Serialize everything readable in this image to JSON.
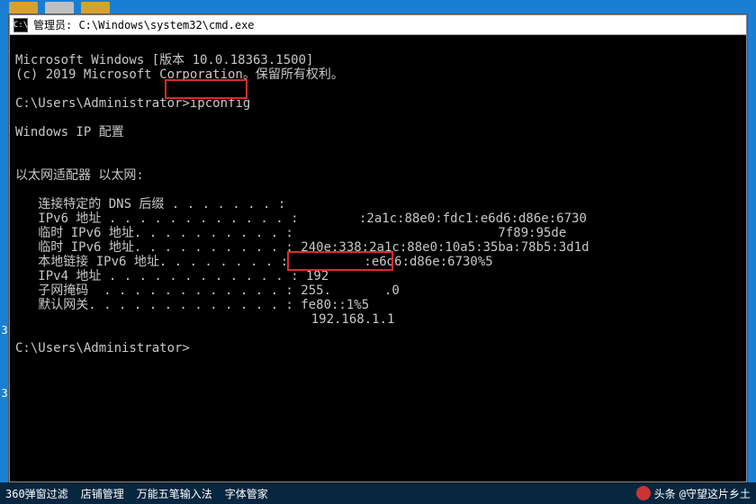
{
  "titlebar": {
    "icon_text": "C:\\",
    "text": "管理员: C:\\Windows\\system32\\cmd.exe"
  },
  "term": {
    "l1": "Microsoft Windows [版本 10.0.18363.1500]",
    "l2": "(c) 2019 Microsoft Corporation。保留所有权利。",
    "l3": "",
    "l4_prompt": "C:\\Users\\Administrator>",
    "l4_cmd": "ipconfig",
    "l5": "",
    "l6": "Windows IP 配置",
    "l7": "",
    "l8": "",
    "l9": "以太网适配器 以太网:",
    "l10": "",
    "l11": "   连接特定的 DNS 后缀 . . . . . . . :",
    "l12": "   IPv6 地址 . . . . . . . . . . . . :        :2a1c:88e0:fdc1:e6d6:d86e:6730",
    "l13": "   临时 IPv6 地址. . . . . . . . . . :                           7f89:95de",
    "l14": "   临时 IPv6 地址. . . . . . . . . . : 240e:338:2a1c:88e0:10a5:35ba:78b5:3d1d",
    "l15": "   本地链接 IPv6 地址. . . . . . . . :          :e6d6:d86e:6730%5",
    "l16": "   IPv4 地址 . . . . . . . . . . . . : 192",
    "l17": "   子网掩码  . . . . . . . . . . . . : 255.       .0",
    "l18": "   默认网关. . . . . . . . . . . . . : fe80::1%5",
    "l19": "                                       192.168.1.1",
    "l20": "",
    "l21": "C:\\Users\\Administrator>"
  },
  "left_markers": {
    "a": "3",
    "b": "3"
  },
  "bottom": {
    "items": [
      "360弹窗过滤",
      "店铺管理",
      "万能五笔输入法",
      "字体管家"
    ],
    "handle_prefix": "头条",
    "handle": "@守望这片乡土"
  }
}
